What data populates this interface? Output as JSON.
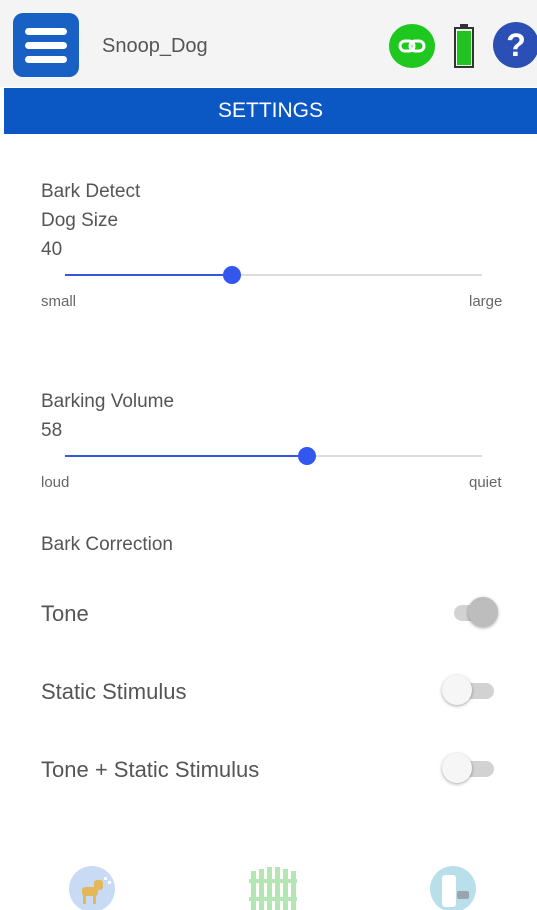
{
  "header": {
    "device_name": "Snoop_Dog",
    "icons": [
      "menu-icon",
      "link-icon",
      "battery-icon",
      "help-icon"
    ],
    "help_glyph": "?",
    "colors": {
      "menu": "#1960c4",
      "link": "#1ec81e",
      "battery": "#22c222",
      "help": "#2b4fb5"
    }
  },
  "title_bar": {
    "title": "SETTINGS",
    "color": "#0b58c4"
  },
  "bark_detect": {
    "section_label": "Bark Detect",
    "dog_size": {
      "label": "Dog Size",
      "value": "40",
      "level_fraction": 0.4,
      "min_label": "small",
      "max_label": "large"
    }
  },
  "barking_volume": {
    "label": "Barking Volume",
    "value": "58",
    "level_fraction": 0.58,
    "min_label": "loud",
    "max_label": "quiet"
  },
  "bark_correction": {
    "section_label": "Bark Correction",
    "options": [
      {
        "label": "Tone",
        "enabled": true
      },
      {
        "label": "Static Stimulus",
        "enabled": false
      },
      {
        "label": "Tone + Static Stimulus",
        "enabled": false
      }
    ]
  },
  "bottom_nav": {
    "items": [
      "dog-bark-icon",
      "fence-icon",
      "remote-device-icon"
    ]
  },
  "accent_color": "#3357dd"
}
